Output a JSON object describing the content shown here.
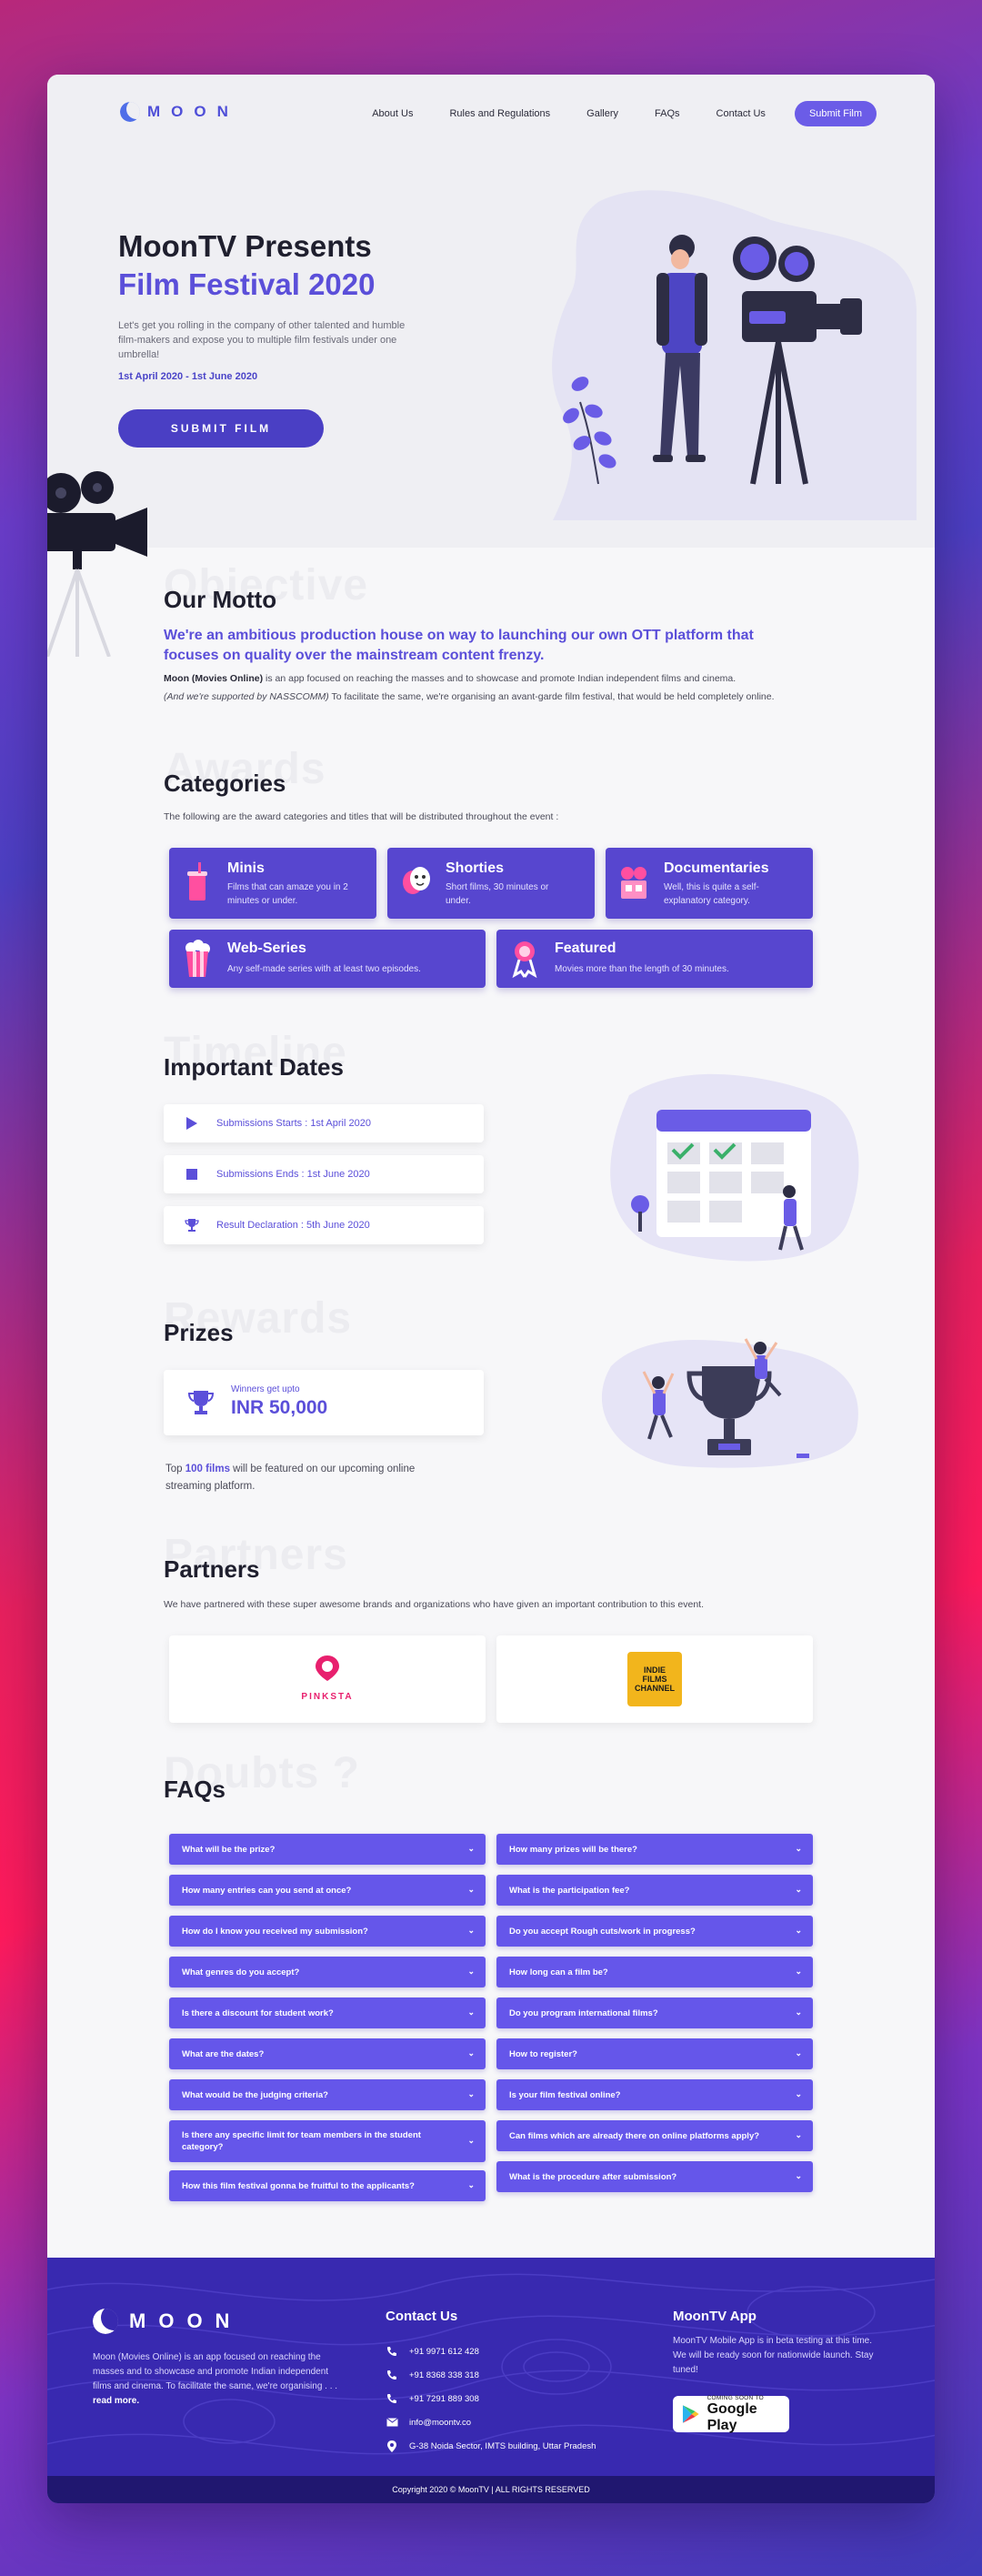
{
  "brand": {
    "logo_text": "MOON"
  },
  "nav": {
    "items": [
      "About Us",
      "Rules and Regulations",
      "Gallery",
      "FAQs",
      "Contact Us"
    ],
    "cta": "Submit Film"
  },
  "hero": {
    "title_line1": "MoonTV Presents",
    "title_line2": "Film Festival 2020",
    "subtitle": "Let's get you rolling in the company of other talented and humble film-makers and expose you to multiple film festivals under one umbrella!",
    "dates": "1st April 2020  -  1st June 2020",
    "button": "SUBMIT FILM"
  },
  "motto": {
    "ghost": "Objective",
    "title": "Our Motto",
    "lead": "We're an ambitious production house on way to launching our own OTT platform that focuses on quality over the mainstream content frenzy.",
    "body_strong": "Moon (Movies Online)",
    "body_1": " is an app focused on reaching the masses and to showcase and promote Indian independent films and cinema.",
    "body_italic": "(And we're supported by NASSCOMM)",
    "body_2": " To facilitate the same, we're organising an avant-garde film festival, that would be held completely online."
  },
  "categories": {
    "ghost": "Awards",
    "title": "Categories",
    "intro": "The following are the award categories and titles that will be distributed throughout the event :",
    "items": [
      {
        "name": "Minis",
        "desc": "Films that can amaze you in 2 minutes or under.",
        "icon": "cup-icon"
      },
      {
        "name": "Shorties",
        "desc": "Short films, 30 minutes or under.",
        "icon": "theater-masks-icon"
      },
      {
        "name": "Documentaries",
        "desc": "Well, this is quite a self-explanatory category.",
        "icon": "film-projector-icon"
      },
      {
        "name": "Web-Series",
        "desc": "Any self-made series with at least two episodes.",
        "icon": "popcorn-icon"
      },
      {
        "name": "Featured",
        "desc": "Movies more than the length of 30 minutes.",
        "icon": "award-ribbon-icon"
      }
    ]
  },
  "dates": {
    "ghost": "Timeline",
    "title": "Important Dates",
    "items": [
      {
        "label": "Submissions Starts   :   1st April 2020",
        "icon": "play-icon"
      },
      {
        "label": "Submissions Ends   :   1st June 2020",
        "icon": "stop-icon"
      },
      {
        "label": "Result Declaration   :   5th June 2020",
        "icon": "trophy-icon"
      }
    ]
  },
  "prizes": {
    "ghost": "Rewards",
    "title": "Prizes",
    "small": "Winners get upto",
    "amount": "INR 50,000",
    "note_pre": "Top ",
    "note_strong": "100 films",
    "note_post": " will be featured on our upcoming online streaming platform."
  },
  "partners": {
    "ghost": "Partners",
    "title": "Partners",
    "intro": "We have partnered with these super awesome brands and organizations who have given an important contribution to this event.",
    "logos": [
      "PINKSTA",
      "INDIE FILMS CHANNEL"
    ]
  },
  "faqs": {
    "ghost": "Doubts ?",
    "title": "FAQs",
    "left": [
      "What will be the prize?",
      "How many entries can you send at once?",
      "How do I know you received my submission?",
      "What genres do you accept?",
      "Is there a discount for student work?",
      "What are the dates?",
      "What would be the judging criteria?",
      "Is there any specific limit for team members in the student category?",
      "How this film festival gonna be fruitful to the applicants?"
    ],
    "right": [
      "How many prizes will be there?",
      "What is the participation fee?",
      "Do you accept Rough cuts/work in progress?",
      "How long can a film be?",
      "Do you program international films?",
      "How to register?",
      "Is your film festival online?",
      "Can films which are already there on online platforms apply?",
      "What is the procedure after submission?"
    ]
  },
  "footer": {
    "logo_text": "MOON",
    "desc": "Moon (Movies Online) is an app focused on reaching the masses and to showcase and promote Indian independent films and cinema. To facilitate the same, we're organising . . . ",
    "read_more": "read more.",
    "contact_title": "Contact Us",
    "contacts": [
      {
        "text": "+91 9971 612 428",
        "icon": "phone-icon"
      },
      {
        "text": "+91 8368 338 318",
        "icon": "phone-icon"
      },
      {
        "text": "+91 7291 889 308",
        "icon": "phone-icon"
      },
      {
        "text": "info@moontv.co",
        "icon": "mail-icon"
      },
      {
        "text": "G-38 Noida Sector, IMTS building, Uttar Pradesh",
        "icon": "location-pin-icon"
      }
    ],
    "app_title": "MoonTV App",
    "app_desc": "MoonTV Mobile App is in beta testing at this time. We will be ready soon for nationwide launch. Stay tuned!",
    "gplay_small": "COMING SOON TO",
    "gplay_big": "Google Play",
    "copyright": "Copyright  2020 © MoonTV   |   ALL RIGHTS RESERVED"
  },
  "colors": {
    "accent": "#5b4fd9",
    "button": "#6556ea",
    "footer": "#3829b0"
  }
}
